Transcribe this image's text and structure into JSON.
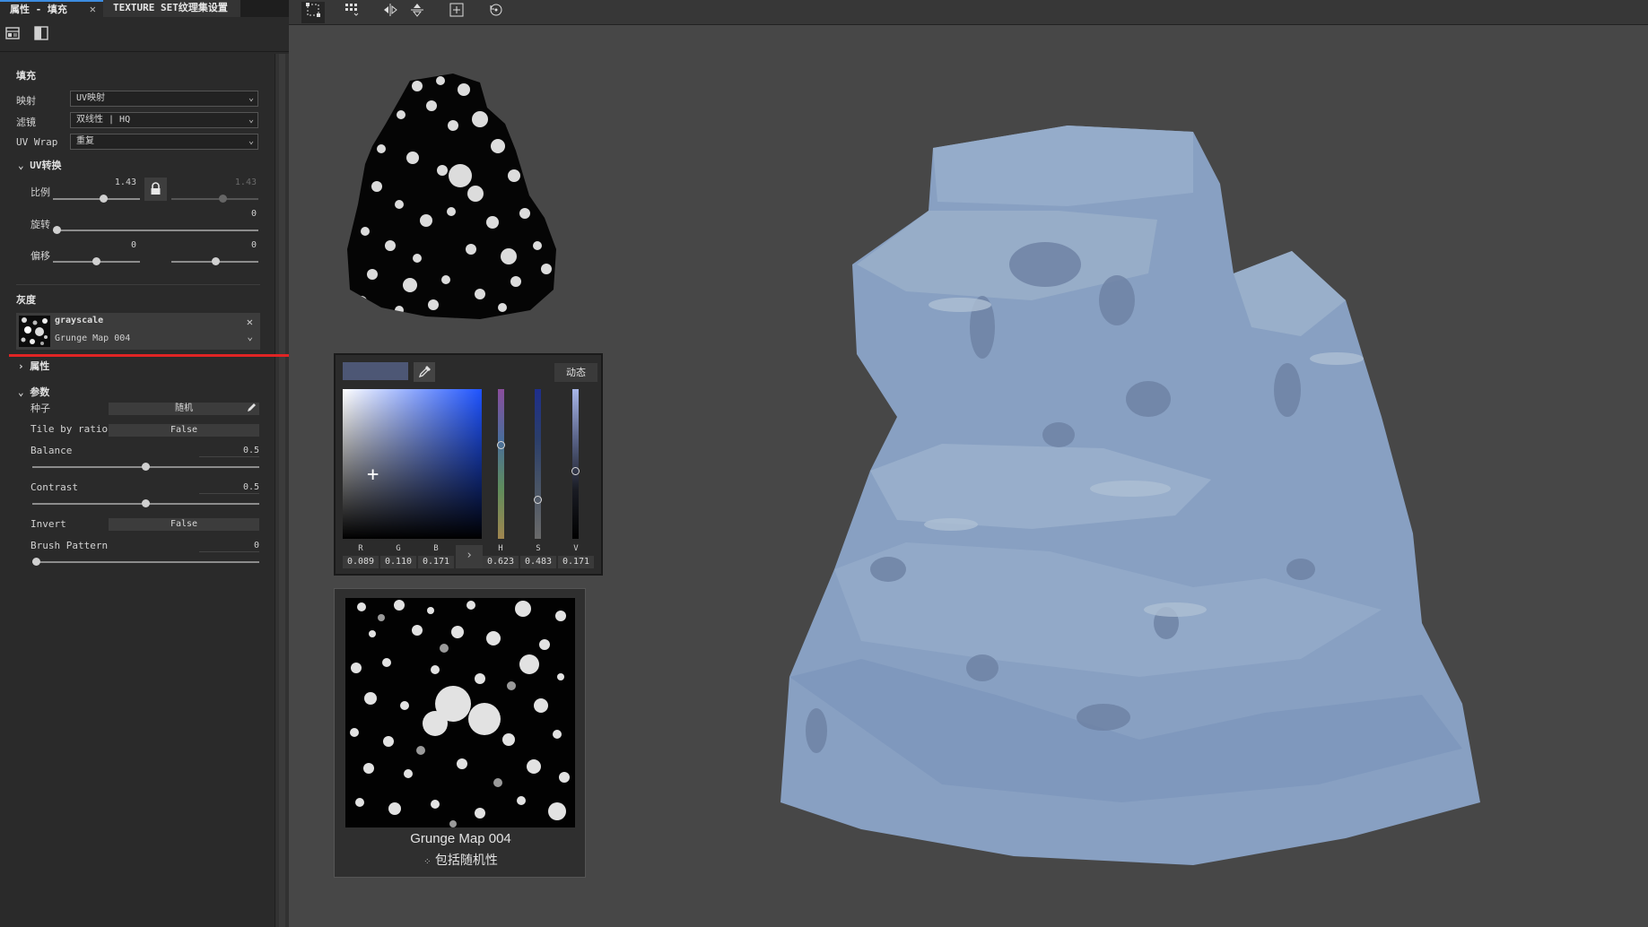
{
  "tabs": [
    {
      "label": "属性 - 填充"
    },
    {
      "label": "TEXTURE SET纹理集设置"
    }
  ],
  "fill": {
    "title": "填充",
    "projection": {
      "label": "映射",
      "value": "UV映射"
    },
    "filter": {
      "label": "滤镜",
      "value": "双线性 | HQ"
    },
    "uvwrap": {
      "label": "UV Wrap",
      "value": "重复"
    }
  },
  "uv_transform": {
    "title": "UV转换",
    "scale": {
      "label": "比例",
      "value_left": "1.43",
      "value_right": "1.43"
    },
    "rotation": {
      "label": "旋转",
      "value": "0"
    },
    "offset": {
      "label": "偏移",
      "value_left": "0",
      "value_right": "0"
    }
  },
  "grayscale": {
    "title": "灰度",
    "resource_name": "grayscale",
    "resource_sub": "Grunge Map 004"
  },
  "attributes": {
    "title": "属性"
  },
  "params": {
    "title": "参数",
    "seed": {
      "label": "种子",
      "value": "随机"
    },
    "tile_by_ratio": {
      "label": "Tile by ratio",
      "value": "False"
    },
    "balance": {
      "label": "Balance",
      "value": "0.5",
      "fraction": 0.5
    },
    "contrast": {
      "label": "Contrast",
      "value": "0.5",
      "fraction": 0.5
    },
    "invert": {
      "label": "Invert",
      "value": "False"
    },
    "brush_pattern": {
      "label": "Brush Pattern",
      "value": "0",
      "fraction": 0
    }
  },
  "color_picker": {
    "mode_button": "动态",
    "channels": [
      {
        "name": "R",
        "value": "0.089"
      },
      {
        "name": "G",
        "value": "0.110"
      },
      {
        "name": "B",
        "value": "0.171"
      },
      {
        "name": "H",
        "value": "0.623"
      },
      {
        "name": "S",
        "value": "0.483"
      },
      {
        "name": "V",
        "value": "0.171"
      }
    ],
    "swatch_color": "#4d5775",
    "accent_color": "#1e53ff"
  },
  "texture_preview": {
    "name": "Grunge Map 004",
    "subtitle": "包括随机性"
  },
  "colors": {
    "highlight_line": "#e02424",
    "rock": "#8fa8c8"
  },
  "icons": [
    "properties-icon",
    "material-icon",
    "lock-icon",
    "eyedropper-icon",
    "pencil-icon",
    "close-icon",
    "chevron-down-icon"
  ]
}
